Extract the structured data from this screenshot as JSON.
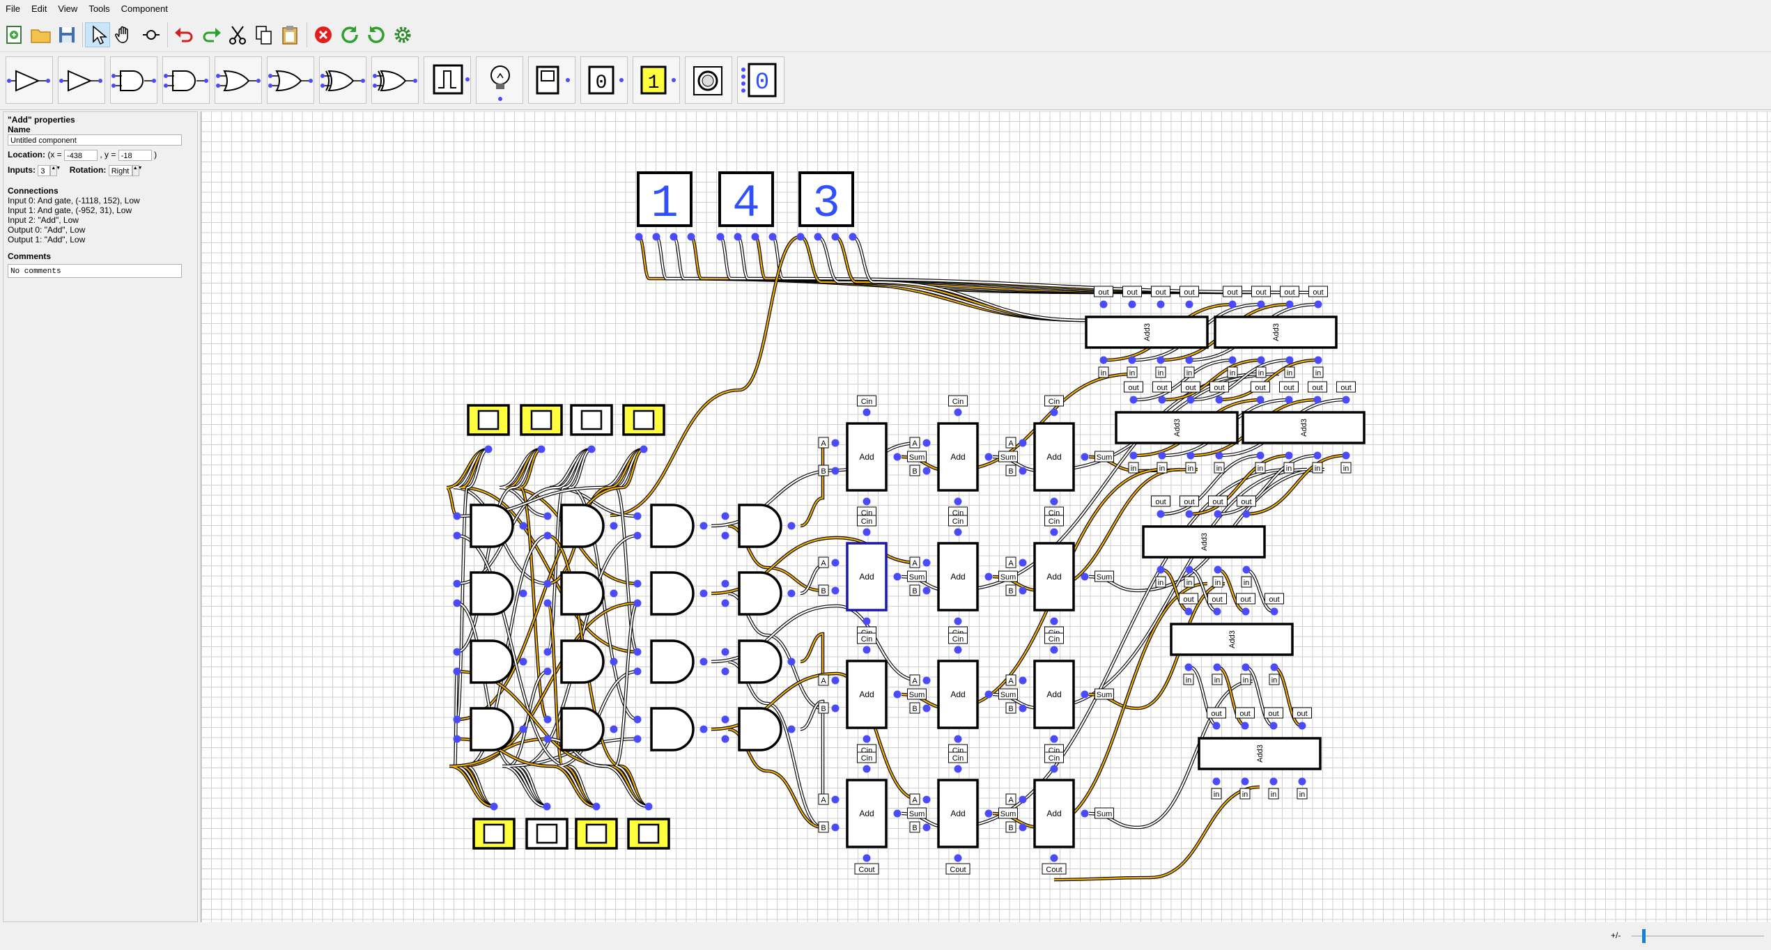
{
  "menu": [
    "File",
    "Edit",
    "View",
    "Tools",
    "Component"
  ],
  "toolbar": {
    "buttons": [
      "new-file-icon",
      "open-folder-icon",
      "save-icon",
      "select-pointer-icon",
      "pan-hand-icon",
      "wire-loop-icon",
      "undo-icon",
      "redo-icon",
      "cut-icon",
      "copy-icon",
      "paste-icon",
      "stop-icon",
      "reset-icon",
      "step-icon",
      "settings-gear-icon"
    ]
  },
  "palette": {
    "items": [
      "buffer-gate-icon",
      "not-gate-icon",
      "and-gate-icon",
      "nand-gate-icon",
      "or-gate-icon",
      "nor-gate-icon",
      "xor-gate-icon",
      "xnor-gate-icon",
      "clock-icon",
      "light-bulb-icon",
      "toggle-switch-icon",
      "constant-zero-icon",
      "constant-one-icon",
      "button-icon",
      "seven-segment-display-icon"
    ],
    "const_zero": "0",
    "const_one": "1",
    "seg_digit": "0"
  },
  "properties": {
    "title": "\"Add\" properties",
    "name_label": "Name",
    "name_value": "Untitled component",
    "location_label": "Location:",
    "loc_x_prefix": "(x =",
    "loc_x": "-438",
    "loc_y_prefix": ", y =",
    "loc_y": "-18",
    "loc_suffix": ")",
    "inputs_label": "Inputs:",
    "inputs_value": "3",
    "rotation_label": "Rotation:",
    "rotation_value": "Right",
    "connections_label": "Connections",
    "connections": [
      "Input 0: And gate, (-1118, 152), Low",
      "Input 1: And gate, (-952, 31), Low",
      "Input 2: \"Add\", Low",
      "Output 0: \"Add\", Low",
      "Output 1: \"Add\", Low"
    ],
    "comments_label": "Comments",
    "comments_value": "No comments"
  },
  "circuit": {
    "digits": [
      "1",
      "4",
      "3"
    ],
    "adder_label": "Add",
    "add3_label": "Add3",
    "pin_a": "A",
    "pin_b": "B",
    "pin_cin": "Cin",
    "pin_cout": "Cout",
    "pin_sum": "Sum",
    "pin_in": "in",
    "pin_out": "out",
    "input_switch_states": [
      true,
      true,
      false,
      true
    ],
    "bottom_switch_states": [
      true,
      false,
      true,
      true
    ]
  },
  "colors": {
    "wire_on": "#f0b000",
    "wire_off": "#ffffff",
    "pin": "#4a4aff",
    "switch_on": "#ffff40",
    "digit": "#3050ff",
    "selection": "#1a1aa0"
  },
  "status": {
    "zoom_label": "+/-",
    "zoom_level": 0.08
  }
}
